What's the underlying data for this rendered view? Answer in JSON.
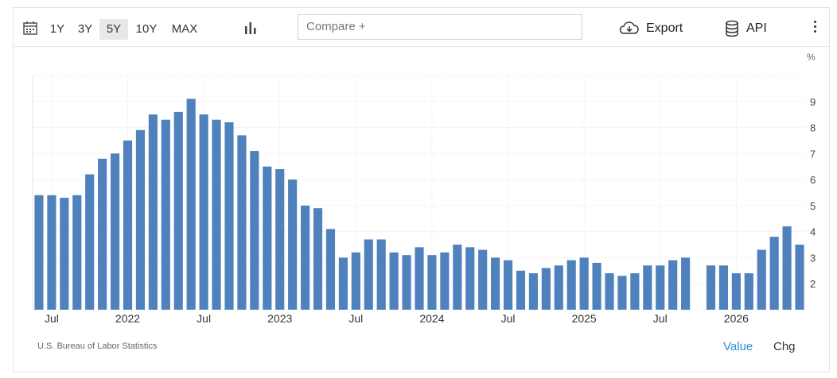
{
  "toolbar": {
    "periods": [
      "1Y",
      "3Y",
      "5Y",
      "10Y",
      "MAX"
    ],
    "active_period": "5Y",
    "compare_placeholder": "Compare +",
    "export_label": "Export",
    "api_label": "API",
    "icons": [
      "calendar-icon",
      "bar-chart-icon",
      "cloud-download-icon",
      "database-icon",
      "more-vert-icon"
    ]
  },
  "unit": "%",
  "footer": {
    "source": "U.S. Bureau of Labor Statistics",
    "value_label": "Value",
    "chg_label": "Chg"
  },
  "colors": {
    "bar": "#4f81bd",
    "active_toggle": "#2a8fd6"
  },
  "chart_data": {
    "type": "bar",
    "grid": true,
    "ylim": [
      1,
      10
    ],
    "yticks": [
      2,
      3,
      4,
      5,
      6,
      7,
      8,
      9
    ],
    "x_tick_labels": [
      "Jul",
      "2022",
      "Jul",
      "2023",
      "Jul",
      "2024",
      "Jul",
      "2025",
      "Jul",
      "2026"
    ],
    "values": [
      5.4,
      5.4,
      5.3,
      5.4,
      6.2,
      6.8,
      7.0,
      7.5,
      7.9,
      8.5,
      8.3,
      8.6,
      9.1,
      8.5,
      8.3,
      8.2,
      7.7,
      7.1,
      6.5,
      6.4,
      6.0,
      5.0,
      4.9,
      4.1,
      3.0,
      3.2,
      3.7,
      3.7,
      3.2,
      3.1,
      3.4,
      3.1,
      3.2,
      3.5,
      3.4,
      3.3,
      3.0,
      2.9,
      2.5,
      2.4,
      2.6,
      2.7,
      2.9,
      3.0,
      2.8,
      2.4,
      2.3,
      2.4,
      2.7,
      2.7,
      2.9,
      3.0,
      null,
      2.7,
      2.7,
      2.4,
      2.4,
      3.3,
      3.8,
      4.2,
      3.5
    ]
  }
}
